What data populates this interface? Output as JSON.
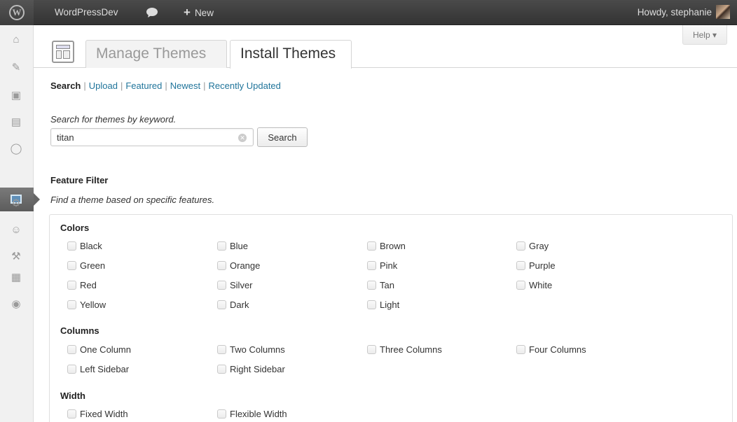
{
  "adminbar": {
    "logo_glyph": "W",
    "site_name": "WordPressDev",
    "comments_icon": "speech-bubble-icon",
    "new_label": "New",
    "new_icon": "plus-icon",
    "greeting": "Howdy, stephanie"
  },
  "help": {
    "label": "Help ▾"
  },
  "tabs": {
    "manage": "Manage Themes",
    "install": "Install Themes",
    "active": "install"
  },
  "subnav": {
    "search": "Search",
    "upload": "Upload",
    "featured": "Featured",
    "newest": "Newest",
    "recently_updated": "Recently Updated",
    "separator": "|"
  },
  "search": {
    "description": "Search for themes by keyword.",
    "value": "titan",
    "button": "Search"
  },
  "feature_filter": {
    "title": "Feature Filter",
    "description": "Find a theme based on specific features."
  },
  "groups": [
    {
      "title": "Colors",
      "options": [
        "Black",
        "Blue",
        "Brown",
        "Gray",
        "Green",
        "Orange",
        "Pink",
        "Purple",
        "Red",
        "Silver",
        "Tan",
        "White",
        "Yellow",
        "Dark",
        "Light"
      ]
    },
    {
      "title": "Columns",
      "options": [
        "One Column",
        "Two Columns",
        "Three Columns",
        "Four Columns",
        "Left Sidebar",
        "Right Sidebar"
      ]
    },
    {
      "title": "Width",
      "options": [
        "Fixed Width",
        "Flexible Width"
      ]
    }
  ],
  "sidemenu_icons": [
    "dashboard-icon",
    "posts-icon",
    "media-icon",
    "pages-icon",
    "comments-icon",
    "appearance-icon",
    "plugins-icon",
    "users-icon",
    "tools-icon",
    "settings-icon",
    "collapse-icon"
  ],
  "colors": {
    "link": "#21759b",
    "adminbar": "#3a3a3a",
    "active_menu": "#6b6b6b"
  }
}
